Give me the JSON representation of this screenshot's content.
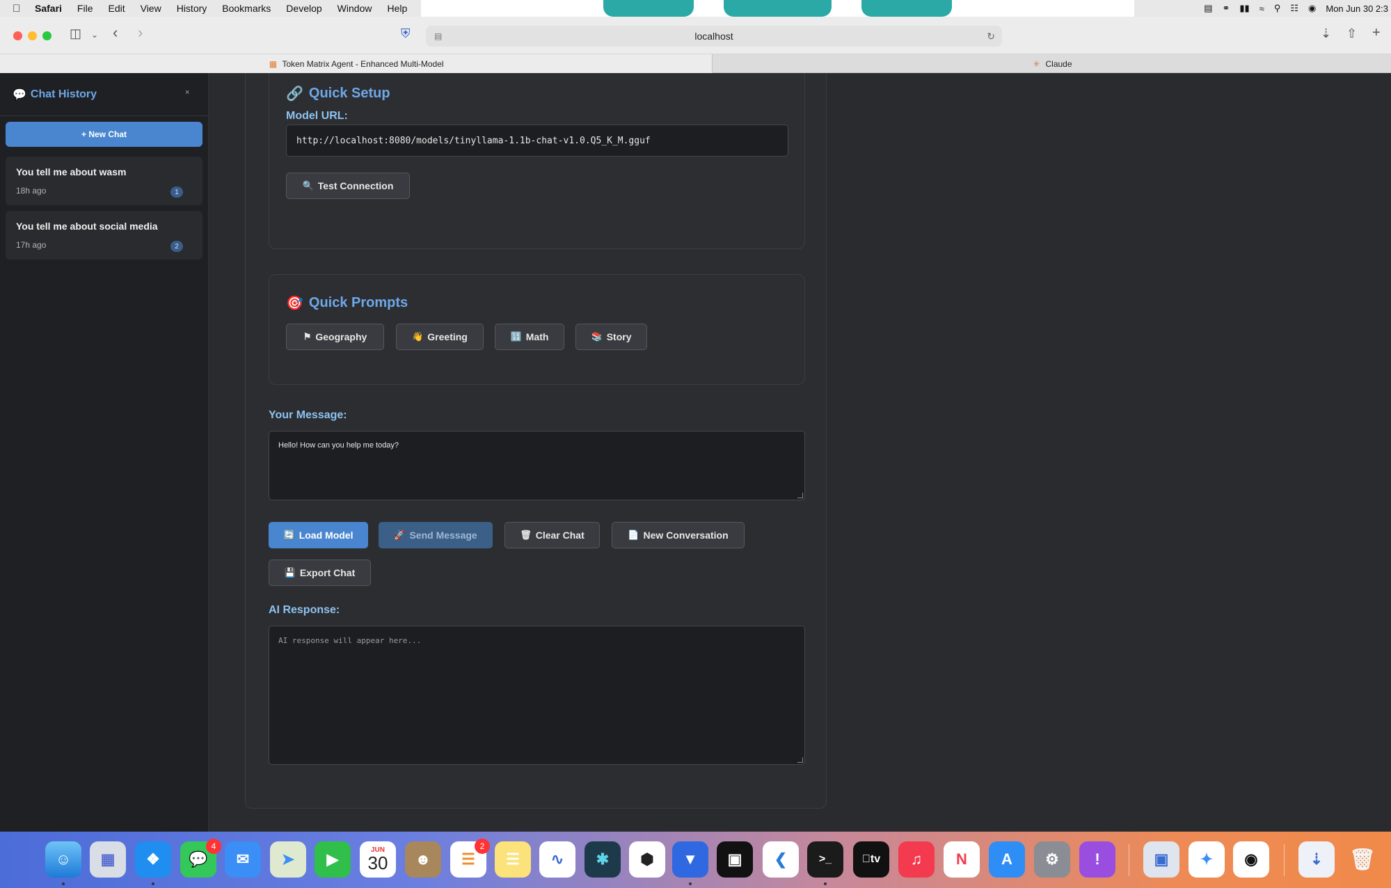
{
  "menubar": {
    "app": "Safari",
    "items": [
      "File",
      "Edit",
      "View",
      "History",
      "Bookmarks",
      "Develop",
      "Window",
      "Help"
    ],
    "clock": "Mon Jun 30  2:3"
  },
  "browser": {
    "address": "localhost",
    "tabs": [
      {
        "title": "Token Matrix Agent - Enhanced Multi-Model",
        "active": true
      },
      {
        "title": "Claude",
        "active": false
      }
    ]
  },
  "sidebar": {
    "title": "Chat History",
    "title_icon": "speech-bubble-icon",
    "close_label": "×",
    "new_chat_label": "+ New Chat",
    "chats": [
      {
        "title": "You tell me about wasm",
        "time": "18h ago",
        "count": "1"
      },
      {
        "title": "You tell me about social media",
        "time": "17h ago",
        "count": "2"
      }
    ]
  },
  "setup": {
    "title": "Quick Setup",
    "title_icon": "link-icon",
    "model_url_label": "Model URL:",
    "model_url_value": "http://localhost:8080/models/tinyllama-1.1b-chat-v1.0.Q5_K_M.gguf",
    "test_button": "Test Connection",
    "test_icon": "magnifier-icon"
  },
  "prompts": {
    "title": "Quick Prompts",
    "title_icon": "target-icon",
    "buttons": [
      {
        "label": "Geography",
        "icon": "france-flag-icon"
      },
      {
        "label": "Greeting",
        "icon": "waving-hand-icon"
      },
      {
        "label": "Math",
        "icon": "numbers-icon"
      },
      {
        "label": "Story",
        "icon": "books-icon"
      }
    ]
  },
  "message": {
    "label": "Your Message:",
    "value": "Hello! How can you help me today?"
  },
  "actions": {
    "load_model": "Load Model",
    "send_message": "Send Message",
    "clear_chat": "Clear Chat",
    "new_conversation": "New Conversation",
    "export_chat": "Export Chat"
  },
  "response": {
    "label": "AI Response:",
    "placeholder": "AI response will appear here..."
  },
  "dock": {
    "calendar_month": "JUN",
    "calendar_day": "30",
    "messages_badge": "4",
    "reminders_badge": "2"
  },
  "colors": {
    "accent": "#4a86cf",
    "title_blue": "#6ea8e8",
    "label_blue": "#8ec3f0",
    "background": "#2a2b2e"
  }
}
